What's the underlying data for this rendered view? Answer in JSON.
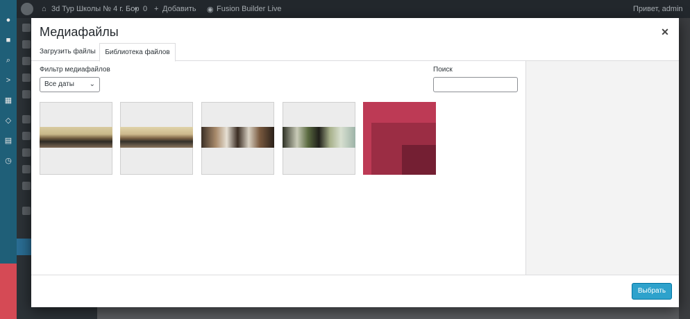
{
  "adminbar": {
    "site_name": "3d Тур Школы № 4 г. Бор",
    "comments_count": "0",
    "add_new": "Добавить",
    "builder": "Fusion Builder Live",
    "greeting": "Привет, admin"
  },
  "modal": {
    "title": "Медиафайлы",
    "close_icon": "✕",
    "tabs": [
      {
        "label": "Загрузить файлы"
      },
      {
        "label": "Библиотека файлов"
      }
    ],
    "filter": {
      "label": "Фильтр медиафайлов",
      "selected": "Все даты"
    },
    "search": {
      "label": "Поиск",
      "value": ""
    },
    "media_items": [
      {
        "kind": "panorama",
        "subject": "classroom-1"
      },
      {
        "kind": "panorama",
        "subject": "classroom-2"
      },
      {
        "kind": "panorama",
        "subject": "hall-windows"
      },
      {
        "kind": "panorama",
        "subject": "corridor"
      },
      {
        "kind": "graphic",
        "subject": "red-squares"
      }
    ],
    "footer": {
      "select_label": "Выбрать"
    }
  },
  "colors": {
    "accent": "#2ea2cc",
    "adminbar_bg": "#23282d",
    "red_tile": "#bd3a55"
  }
}
